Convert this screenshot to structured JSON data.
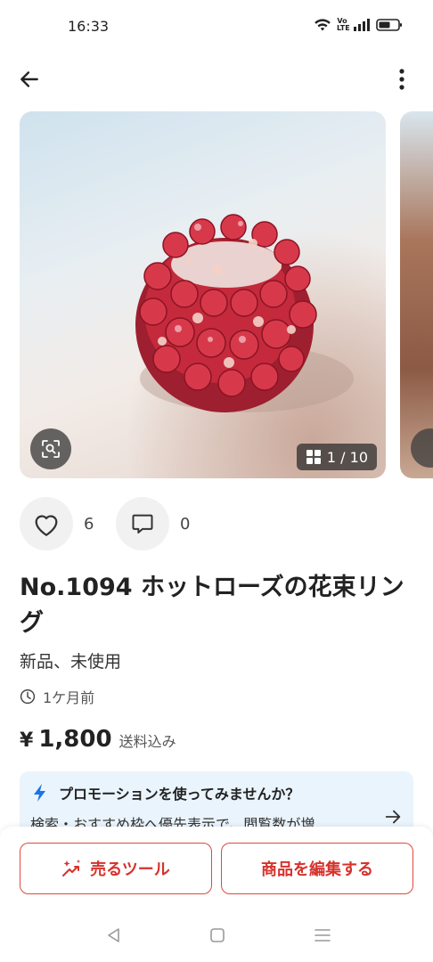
{
  "status_bar": {
    "time": "16:33",
    "volte_top": "Vo",
    "volte_bottom": "LTE"
  },
  "app_bar": {
    "back_icon": "arrow-left-icon",
    "menu_icon": "more-vertical-icon"
  },
  "gallery": {
    "counter": "1 / 10",
    "grid_icon": "grid-icon",
    "lens_icon": "image-search-icon"
  },
  "reactions": {
    "like_icon": "heart-icon",
    "like_count": "6",
    "comment_icon": "comment-icon",
    "comment_count": "0"
  },
  "item": {
    "title": "No.1094 ホットローズの花束リング",
    "condition": "新品、未使用",
    "posted": "1ケ月前",
    "price_currency": "¥",
    "price": "1,800",
    "price_note": "送料込み"
  },
  "promo": {
    "icon": "lightning-icon",
    "title": "プロモーションを使ってみませんか？",
    "body": "検索・おすすめ枠へ優先表示で、閲覧数が増",
    "arrow_icon": "arrow-right-icon"
  },
  "actions": {
    "sell_tools_label": "売るツール",
    "edit_label": "商品を編集する"
  },
  "colors": {
    "accent_red": "#d7322c",
    "promo_bg": "#eaf4fc",
    "lightning_blue": "#1a73e8"
  }
}
